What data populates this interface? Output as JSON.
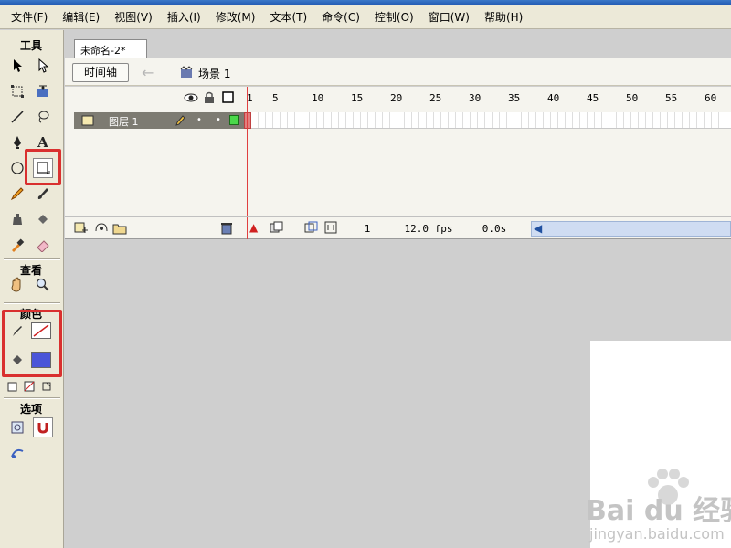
{
  "menu": [
    "文件(F)",
    "编辑(E)",
    "视图(V)",
    "插入(I)",
    "修改(M)",
    "文本(T)",
    "命令(C)",
    "控制(O)",
    "窗口(W)",
    "帮助(H)"
  ],
  "tools_panel": {
    "title": "工具",
    "view_title": "查看",
    "color_title": "颜色",
    "options_title": "选项",
    "tool_icons": [
      "arrow-tool-icon",
      "subselect-tool-icon",
      "free-transform-icon",
      "fill-transform-icon",
      "line-tool-icon",
      "lasso-tool-icon",
      "pen-tool-icon",
      "text-tool-icon",
      "oval-tool-icon",
      "rectangle-tool-icon",
      "pencil-tool-icon",
      "brush-tool-icon",
      "ink-bottle-icon",
      "paint-bucket-icon",
      "eyedropper-icon",
      "eraser-icon"
    ],
    "text_tool_glyph": "A",
    "stroke_color": "#ffffff",
    "fill_color": "#4a55d8",
    "highlight_color": "#d9302f"
  },
  "document": {
    "tab_label": "未命名-2*",
    "timeline_button": "时间轴",
    "scene_label": "场景 1"
  },
  "timeline": {
    "ruler": [
      "1",
      "5",
      "10",
      "15",
      "20",
      "25",
      "30",
      "35",
      "40",
      "45",
      "50",
      "55",
      "60"
    ],
    "layer_name": "图层 1",
    "current_frame": "1",
    "frame_rate": "12.0 fps",
    "elapsed_time": "0.0s"
  },
  "watermark": {
    "brand": "Bai du 经验",
    "url": "jingyan.baidu.com"
  }
}
